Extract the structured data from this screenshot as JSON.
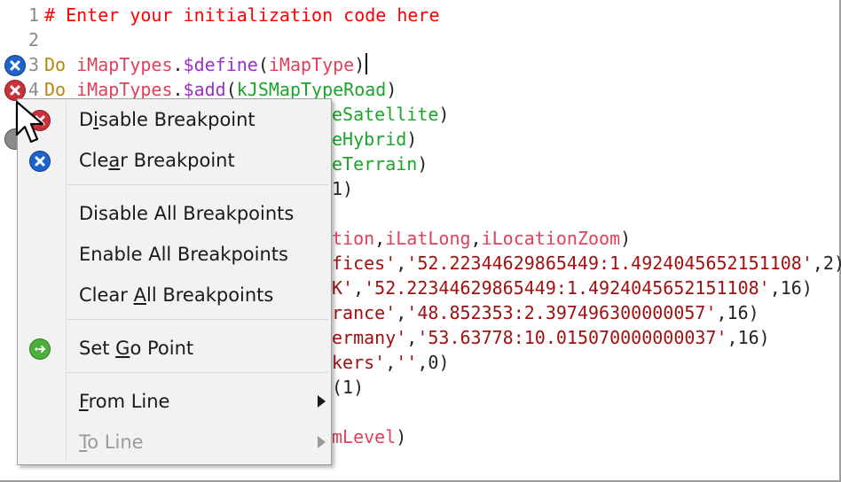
{
  "editor": {
    "lines": [
      {
        "num": "1",
        "segments": [
          {
            "t": "# Enter your initialization code here",
            "c": "cm"
          }
        ]
      },
      {
        "num": "2",
        "segments": []
      },
      {
        "num": "3",
        "segments": [
          {
            "t": "Do ",
            "c": "kw"
          },
          {
            "t": "iMapTypes",
            "c": "id"
          },
          {
            "t": ".",
            "c": "plain"
          },
          {
            "t": "$define",
            "c": "mth"
          },
          {
            "t": "(",
            "c": "plain"
          },
          {
            "t": "iMapType",
            "c": "id"
          },
          {
            "t": ")",
            "c": "plain"
          }
        ]
      },
      {
        "num": "4",
        "segments": [
          {
            "t": "Do ",
            "c": "kw"
          },
          {
            "t": "iMapTypes",
            "c": "id"
          },
          {
            "t": ".",
            "c": "plain"
          },
          {
            "t": "$add",
            "c": "mth"
          },
          {
            "t": "(",
            "c": "plain"
          },
          {
            "t": "kJSMapTypeRoad",
            "c": "const"
          },
          {
            "t": ")",
            "c": "plain"
          }
        ]
      }
    ],
    "partial_lines": [
      [
        {
          "t": "eSatellite",
          "c": "const"
        },
        {
          "t": ")",
          "c": "plain"
        }
      ],
      [
        {
          "t": "eHybrid",
          "c": "const"
        },
        {
          "t": ")",
          "c": "plain"
        }
      ],
      [
        {
          "t": "eTerrain",
          "c": "const"
        },
        {
          "t": ")",
          "c": "plain"
        }
      ],
      [
        {
          "t": "1)",
          "c": "plain"
        }
      ],
      [],
      [
        {
          "t": "tion",
          "c": "id"
        },
        {
          "t": ",",
          "c": "plain"
        },
        {
          "t": "iLatLong",
          "c": "id"
        },
        {
          "t": ",",
          "c": "plain"
        },
        {
          "t": "iLocationZoom",
          "c": "id"
        },
        {
          "t": ")",
          "c": "plain"
        }
      ],
      [
        {
          "t": "fices'",
          "c": "str"
        },
        {
          "t": ",",
          "c": "plain"
        },
        {
          "t": "'52.22344629865449:1.4924045652151108'",
          "c": "str"
        },
        {
          "t": ",2)",
          "c": "plain"
        }
      ],
      [
        {
          "t": "K'",
          "c": "str"
        },
        {
          "t": ",",
          "c": "plain"
        },
        {
          "t": "'52.22344629865449:1.4924045652151108'",
          "c": "str"
        },
        {
          "t": ",16)",
          "c": "plain"
        }
      ],
      [
        {
          "t": "rance'",
          "c": "str"
        },
        {
          "t": ",",
          "c": "plain"
        },
        {
          "t": "'48.852353:2.397496300000057'",
          "c": "str"
        },
        {
          "t": ",16)",
          "c": "plain"
        }
      ],
      [
        {
          "t": "ermany'",
          "c": "str"
        },
        {
          "t": ",",
          "c": "plain"
        },
        {
          "t": "'53.63778:10.015070000000037'",
          "c": "str"
        },
        {
          "t": ",16)",
          "c": "plain"
        }
      ],
      [
        {
          "t": "kers'",
          "c": "str"
        },
        {
          "t": ",",
          "c": "plain"
        },
        {
          "t": "''",
          "c": "str"
        },
        {
          "t": ",0)",
          "c": "plain"
        }
      ],
      [
        {
          "t": "(1)",
          "c": "plain"
        }
      ],
      [],
      [
        {
          "t": "mLevel",
          "c": "id"
        },
        {
          "t": ")",
          "c": "plain"
        }
      ]
    ]
  },
  "context_menu": {
    "groups": [
      [
        {
          "label_pre": "D",
          "label_ul": "i",
          "label_post": "sable Breakpoint",
          "icon": "breakpoint-red-icon",
          "submenu": false,
          "disabled": false
        },
        {
          "label_pre": "Cle",
          "label_ul": "a",
          "label_post": "r Breakpoint",
          "icon": "clear-breakpoint-icon",
          "submenu": false,
          "disabled": false
        }
      ],
      [
        {
          "label_pre": "Disable All Breakpoints",
          "label_ul": "",
          "label_post": "",
          "icon": "",
          "submenu": false,
          "disabled": false
        },
        {
          "label_pre": "Enable All Breakpoints",
          "label_ul": "",
          "label_post": "",
          "icon": "",
          "submenu": false,
          "disabled": false
        },
        {
          "label_pre": "Clear ",
          "label_ul": "A",
          "label_post": "ll Breakpoints",
          "icon": "",
          "submenu": false,
          "disabled": false
        }
      ],
      [
        {
          "label_pre": "Set ",
          "label_ul": "G",
          "label_post": "o Point",
          "icon": "go-point-icon",
          "submenu": false,
          "disabled": false
        }
      ],
      [
        {
          "label_pre": "",
          "label_ul": "F",
          "label_post": "rom Line",
          "icon": "",
          "submenu": true,
          "disabled": false
        },
        {
          "label_pre": "",
          "label_ul": "T",
          "label_post": "o Line",
          "icon": "",
          "submenu": true,
          "disabled": true
        }
      ]
    ]
  },
  "colors": {
    "comment": "#ff0000",
    "keyword": "#b8860b",
    "identifier": "#e0405a",
    "method": "#9b30c8",
    "constant": "#1aa62a",
    "string": "#a01010",
    "breakpoint_blue": "#1e63c8",
    "breakpoint_red": "#c8323a",
    "go_point": "#4caf3a"
  }
}
